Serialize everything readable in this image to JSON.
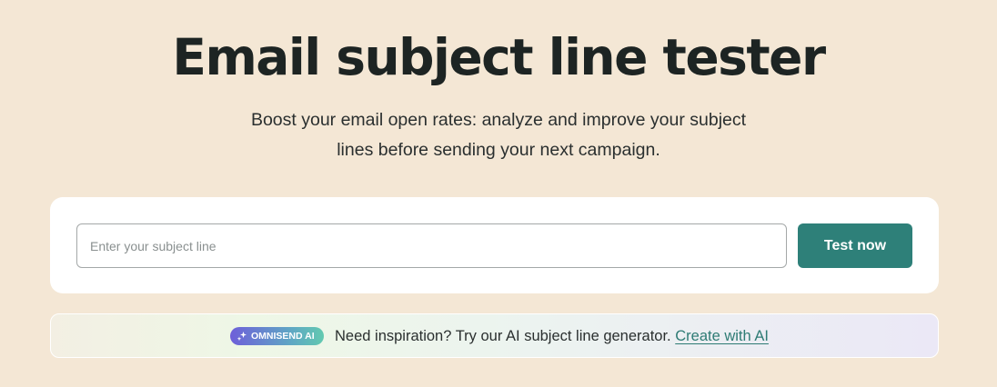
{
  "header": {
    "title": "Email subject line tester",
    "subtitle_line1": "Boost your email open rates: analyze and improve your subject",
    "subtitle_line2": "lines before sending your next campaign."
  },
  "tester": {
    "input_placeholder": "Enter your subject line",
    "input_value": "",
    "button_label": "Test now"
  },
  "ai_banner": {
    "badge_icon": "sparkle-icon",
    "badge_label": "OMNISEND AI",
    "text": "Need inspiration? Try our AI subject line generator.",
    "link_label": "Create with AI"
  },
  "colors": {
    "page_background": "#f4e7d5",
    "accent": "#2e8079",
    "link": "#2e7b74",
    "title_text": "#1d2423"
  }
}
